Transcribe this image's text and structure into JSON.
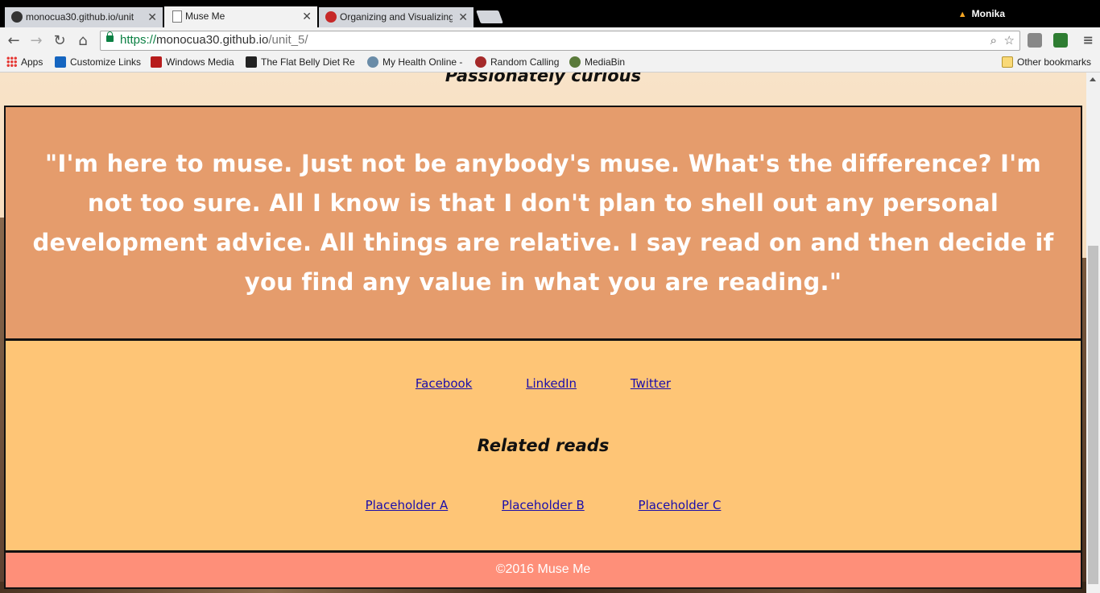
{
  "browser": {
    "tabs": [
      {
        "title": "monocua30.github.io/unit",
        "icon": "github-icon",
        "active": false
      },
      {
        "title": "Muse Me",
        "icon": "document-icon",
        "active": true
      },
      {
        "title": "Organizing and Visualizing",
        "icon": "ga-icon",
        "active": false
      }
    ],
    "user": "Monika",
    "url": {
      "scheme": "https://",
      "host": "monocua30.github.io",
      "path": "/unit_5/"
    },
    "bookmarks": [
      {
        "label": "Apps",
        "icon": "apps-grid-icon"
      },
      {
        "label": "Customize Links",
        "icon": "m-logo-icon",
        "color": "#1565c0"
      },
      {
        "label": "Windows Media",
        "icon": "windows-media-icon",
        "color": "#b71c1c"
      },
      {
        "label": "The Flat Belly Diet Rev",
        "icon": "webmd-icon",
        "color": "#222222"
      },
      {
        "label": "My Health Online -",
        "icon": "health-icon",
        "color": "#6a8ca8"
      },
      {
        "label": "Random Calling",
        "icon": "apple-icon",
        "color": "#a52a2a"
      },
      {
        "label": "MediaBin",
        "icon": "mediabin-icon",
        "color": "#5a7a3a"
      }
    ],
    "other_bookmarks": "Other bookmarks"
  },
  "page": {
    "tagline": "Passionately curious",
    "quote": "\"I'm here to muse. Just not be anybody's muse. What's the difference? I'm not too sure. All I know is that I don't plan to shell out any personal development advice. All things are relative. I say read on and then decide if you find any value in what you are reading.\"",
    "social_links": [
      "Facebook",
      "LinkedIn",
      "Twitter"
    ],
    "related_heading": "Related reads",
    "related_links": [
      "Placeholder A",
      "Placeholder B",
      "Placeholder C"
    ],
    "footer": "©2016 Muse Me"
  },
  "colors": {
    "quote_bg": "#e59c6c",
    "links_bg": "#fec576",
    "footer_bg": "#fe8f79",
    "link": "#1a0dab"
  }
}
